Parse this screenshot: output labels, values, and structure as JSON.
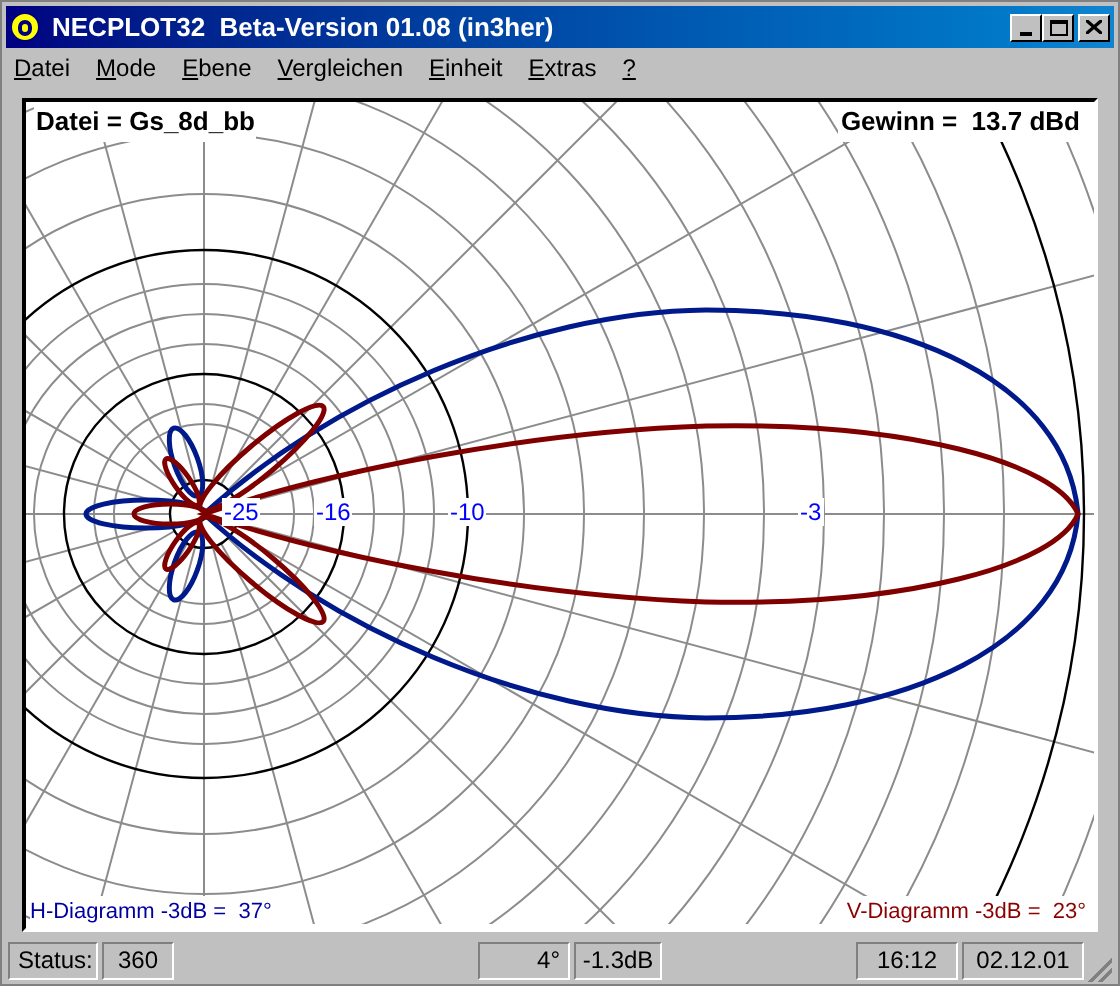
{
  "window": {
    "title": "NECPLOT32  Beta-Version 01.08 (in3her)"
  },
  "menu": [
    "Datei",
    "Mode",
    "Ebene",
    "Vergleichen",
    "Einheit",
    "Extras",
    "?"
  ],
  "plot": {
    "file_label": "Datei = Gs_8d_bb",
    "gain_label": "Gewinn =  13.7 dBd",
    "ring_labels": [
      "-25",
      "-16",
      "-10",
      "-3"
    ],
    "h_label": "H-Diagramm -3dB =  37°",
    "v_label": "V-Diagramm -3dB =  23°"
  },
  "status_bar": [
    "Status:",
    "360",
    "4°",
    "-1.3dB",
    "16:12",
    "02.12.01"
  ]
}
